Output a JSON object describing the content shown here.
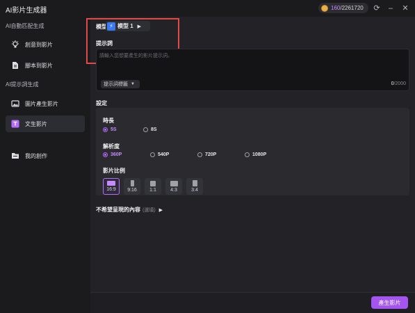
{
  "app": {
    "title": "AI影片生成器"
  },
  "credits": {
    "current": "160",
    "total": "/2261720"
  },
  "sidebar": {
    "section1": "AI自動匹配生成",
    "section2": "AI提示詞生成",
    "items": [
      {
        "label": "創意到影片",
        "icon": "lightbulb-icon"
      },
      {
        "label": "腳本到影片",
        "icon": "document-icon"
      },
      {
        "label": "圖片產生影片",
        "icon": "image-icon"
      },
      {
        "label": "文生影片",
        "icon": "text-icon"
      },
      {
        "label": "我的創作",
        "icon": "folder-icon"
      }
    ]
  },
  "main": {
    "model_label": "模型",
    "model_value": "模型 1",
    "prompt_label": "提示詞",
    "prompt_placeholder": "請輸入您想要產生的影片提示詞。",
    "prompt_tags": "提示詞標籤",
    "counter_current": "0",
    "counter_max": "/2000",
    "settings_label": "設定",
    "duration_label": "時長",
    "durations": [
      "5S",
      "8S"
    ],
    "resolution_label": "解析度",
    "resolutions": [
      "360P",
      "540P",
      "720P",
      "1080P"
    ],
    "ratio_label": "影片比例",
    "ratios": [
      "16:9",
      "9:16",
      "1:1",
      "4:3",
      "3:4"
    ],
    "negative_label": "不希望呈現的內容",
    "negative_optional": "(選填)",
    "generate_button": "產生影片"
  },
  "colors": {
    "accent": "#a455f0",
    "highlight_box": "#e24a4a"
  }
}
